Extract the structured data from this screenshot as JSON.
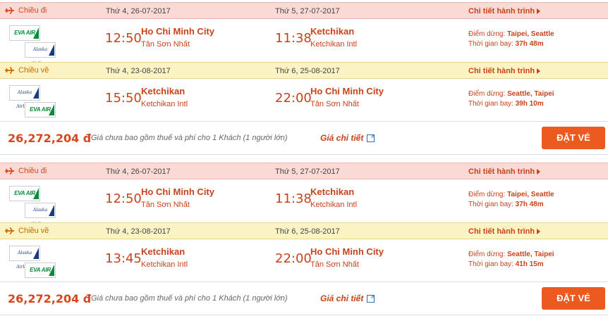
{
  "labels": {
    "depart": "Chiều đi",
    "return": "Chiều về",
    "detail_link": "Chi tiết hành trình",
    "stops_label": "Điểm dừng:",
    "duration_label": "Thời gian bay:",
    "price_note": "Giá chưa bao gồm thuế và phí cho 1 Khách (1 người lớn)",
    "price_detail": "Giá chi tiết",
    "book": "ĐẶT VÉ"
  },
  "airlines": {
    "eva": "EVA AIR",
    "alaska": "Alaska Airlines"
  },
  "colors": {
    "accent": "#c8421a",
    "depart_header_bg": "#fbd9d4",
    "return_header_bg": "#fbf3c4",
    "book_button": "#ec5a1f"
  },
  "offers": [
    {
      "outbound": {
        "dep_date": "Thứ 4, 26-07-2017",
        "arr_date": "Thứ 5, 27-07-2017",
        "dep_time": "12:50",
        "dep_city": "Ho Chi Minh City",
        "dep_airport": "Tân Sơn Nhất",
        "arr_time": "11:38",
        "arr_city": "Ketchikan",
        "arr_airport": "Ketchikan Intl",
        "stops": "Taipei, Seattle",
        "duration": "37h 48m"
      },
      "inbound": {
        "dep_date": "Thứ 4, 23-08-2017",
        "arr_date": "Thứ 6, 25-08-2017",
        "dep_time": "15:50",
        "dep_city": "Ketchikan",
        "dep_airport": "Ketchikan Intl",
        "arr_time": "22:00",
        "arr_city": "Ho Chi Minh City",
        "arr_airport": "Tân Sơn Nhất",
        "stops": "Seattle, Taipei",
        "duration": "39h 10m"
      },
      "price": "26,272,204 đ"
    },
    {
      "outbound": {
        "dep_date": "Thứ 4, 26-07-2017",
        "arr_date": "Thứ 5, 27-07-2017",
        "dep_time": "12:50",
        "dep_city": "Ho Chi Minh City",
        "dep_airport": "Tân Sơn Nhất",
        "arr_time": "11:38",
        "arr_city": "Ketchikan",
        "arr_airport": "Ketchikan Intl",
        "stops": "Taipei, Seattle",
        "duration": "37h 48m"
      },
      "inbound": {
        "dep_date": "Thứ 4, 23-08-2017",
        "arr_date": "Thứ 6, 25-08-2017",
        "dep_time": "13:45",
        "dep_city": "Ketchikan",
        "dep_airport": "Ketchikan Intl",
        "arr_time": "22:00",
        "arr_city": "Ho Chi Minh City",
        "arr_airport": "Tân Sơn Nhất",
        "stops": "Seattle, Taipei",
        "duration": "41h 15m"
      },
      "price": "26,272,204 đ"
    }
  ]
}
